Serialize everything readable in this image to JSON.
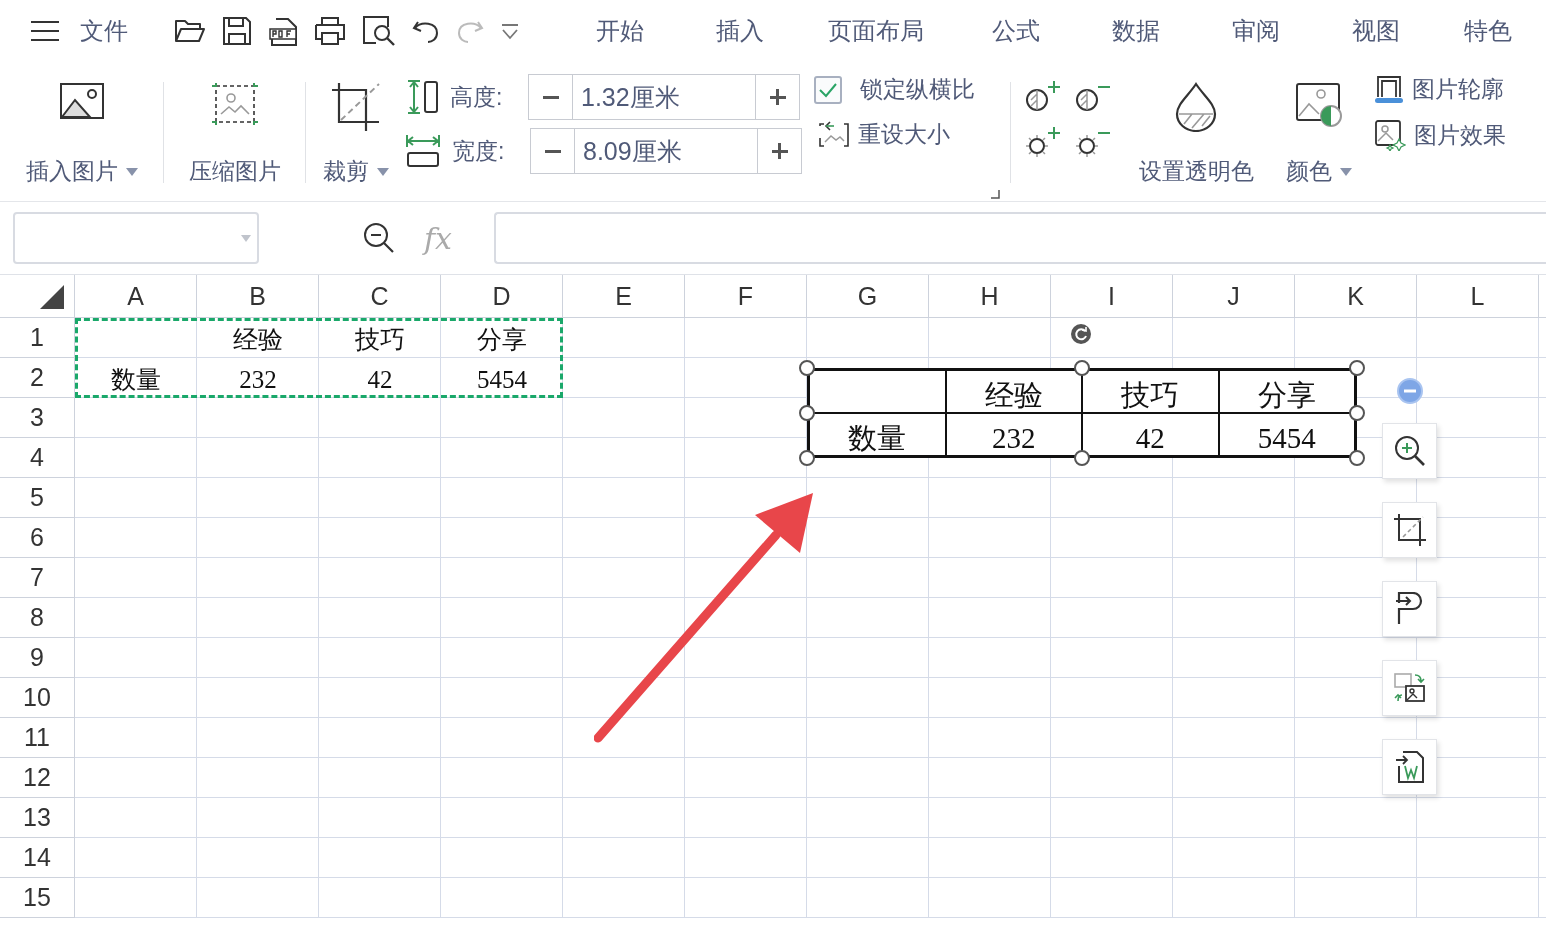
{
  "menu": {
    "file": "文件",
    "tabs": [
      "开始",
      "插入",
      "页面布局",
      "公式",
      "数据",
      "审阅",
      "视图",
      "特色"
    ]
  },
  "ribbon": {
    "insert_picture": {
      "label": "插入图片",
      "dropdown": true
    },
    "compress": {
      "label": "压缩图片"
    },
    "crop": {
      "label": "裁剪",
      "dropdown": true
    },
    "height": {
      "label": "高度:",
      "value": "1.32厘米"
    },
    "width": {
      "label": "宽度:",
      "value": "8.09厘米"
    },
    "lock_ratio": {
      "label": "锁定纵横比",
      "checked": true
    },
    "reset_size": {
      "label": "重设大小"
    },
    "transparent": {
      "label": "设置透明色"
    },
    "color": {
      "label": "颜色",
      "dropdown": true
    },
    "outline": {
      "label": "图片轮廓"
    },
    "effects": {
      "label": "图片效果"
    }
  },
  "formula_bar": {
    "fx": "fx"
  },
  "sheet": {
    "columns": [
      "A",
      "B",
      "C",
      "D",
      "E",
      "F",
      "G",
      "H",
      "I",
      "J",
      "K",
      "L"
    ],
    "rows": [
      "1",
      "2",
      "3",
      "4",
      "5",
      "6",
      "7",
      "8",
      "9",
      "10",
      "11",
      "12",
      "13",
      "14",
      "15"
    ],
    "cells": [
      [
        null,
        "经验",
        "技巧",
        "分享"
      ],
      [
        "数量",
        "232",
        "42",
        "5454"
      ]
    ],
    "copy_marquee": true
  },
  "picture_object": {
    "selected": true,
    "cells": [
      [
        null,
        "经验",
        "技巧",
        "分享"
      ],
      [
        "数量",
        "232",
        "42",
        "5454"
      ]
    ]
  }
}
